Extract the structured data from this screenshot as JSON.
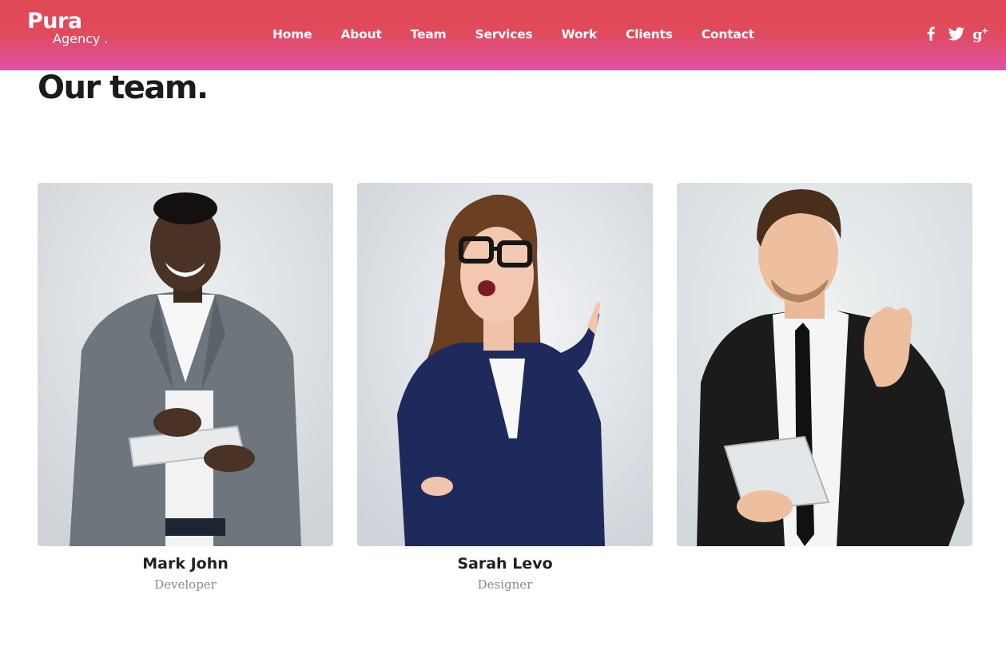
{
  "brand": {
    "name": "Pura",
    "tagline": "Agency ."
  },
  "nav": {
    "items": [
      {
        "label": "Home"
      },
      {
        "label": "About"
      },
      {
        "label": "Team"
      },
      {
        "label": "Services"
      },
      {
        "label": "Work"
      },
      {
        "label": "Clients"
      },
      {
        "label": "Contact"
      }
    ]
  },
  "social": {
    "icons": [
      "facebook-icon",
      "twitter-icon",
      "google-plus-icon"
    ]
  },
  "colors": {
    "header_gradient_top": "#e04a55",
    "header_gradient_bottom": "#e052a6",
    "title": "#1b1b1b",
    "role_text": "#8a8a8a"
  },
  "team": {
    "title": "Our team.",
    "members": [
      {
        "name": "Mark John",
        "role": "Developer"
      },
      {
        "name": "Sarah Levo",
        "role": "Designer"
      },
      {
        "name": "",
        "role": ""
      }
    ]
  }
}
